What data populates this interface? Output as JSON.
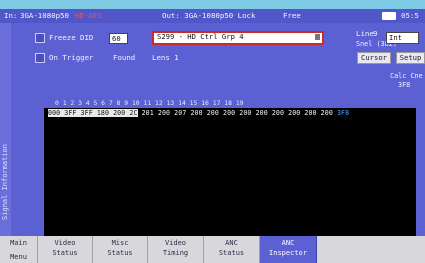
{
  "status": {
    "input_prefix": "In: ",
    "input_format": "3GA-1080p50",
    "input_warning": "HD-AES",
    "output": "Out: 3GA-1080p50  Lock",
    "free": "Free",
    "clock": "05:5"
  },
  "sidebar": {
    "label": "Signal Information"
  },
  "controls": {
    "freeze_label": "Freeze",
    "did_label": "DID",
    "did_value": "60",
    "packet_select": "S299 - HD Ctrl Grp 4",
    "on_trigger_label": "On Trigger",
    "found_label": "Found",
    "lens_label": "Lens 1",
    "line_label": "Line",
    "line_value": "9",
    "line_mode": "Int",
    "snel_label": "Snel (382)",
    "cursor_label": "Cursor",
    "setup_label": "Setup",
    "calc_label": "Calc Cne",
    "calc_value": "3F8"
  },
  "hex": {
    "header": "0  1  2  3  4  5  6  7  8  9 10 11 12 13 14 15 16 17 18 19",
    "row_first": "000 3FF 3FF 180 200 2C",
    "row_rest": " 201 200 207 200 200 200 200 200 200 200 200 200 ",
    "row_selected": "3F8"
  },
  "menu": {
    "items": [
      {
        "line1": "Main Menu",
        "line2": ""
      },
      {
        "line1": "Video",
        "line2": "Status"
      },
      {
        "line1": "Misc",
        "line2": "Status"
      },
      {
        "line1": "Video",
        "line2": "Timing"
      },
      {
        "line1": "ANC",
        "line2": "Status"
      },
      {
        "line1": "ANC",
        "line2": "Inspector"
      }
    ]
  }
}
